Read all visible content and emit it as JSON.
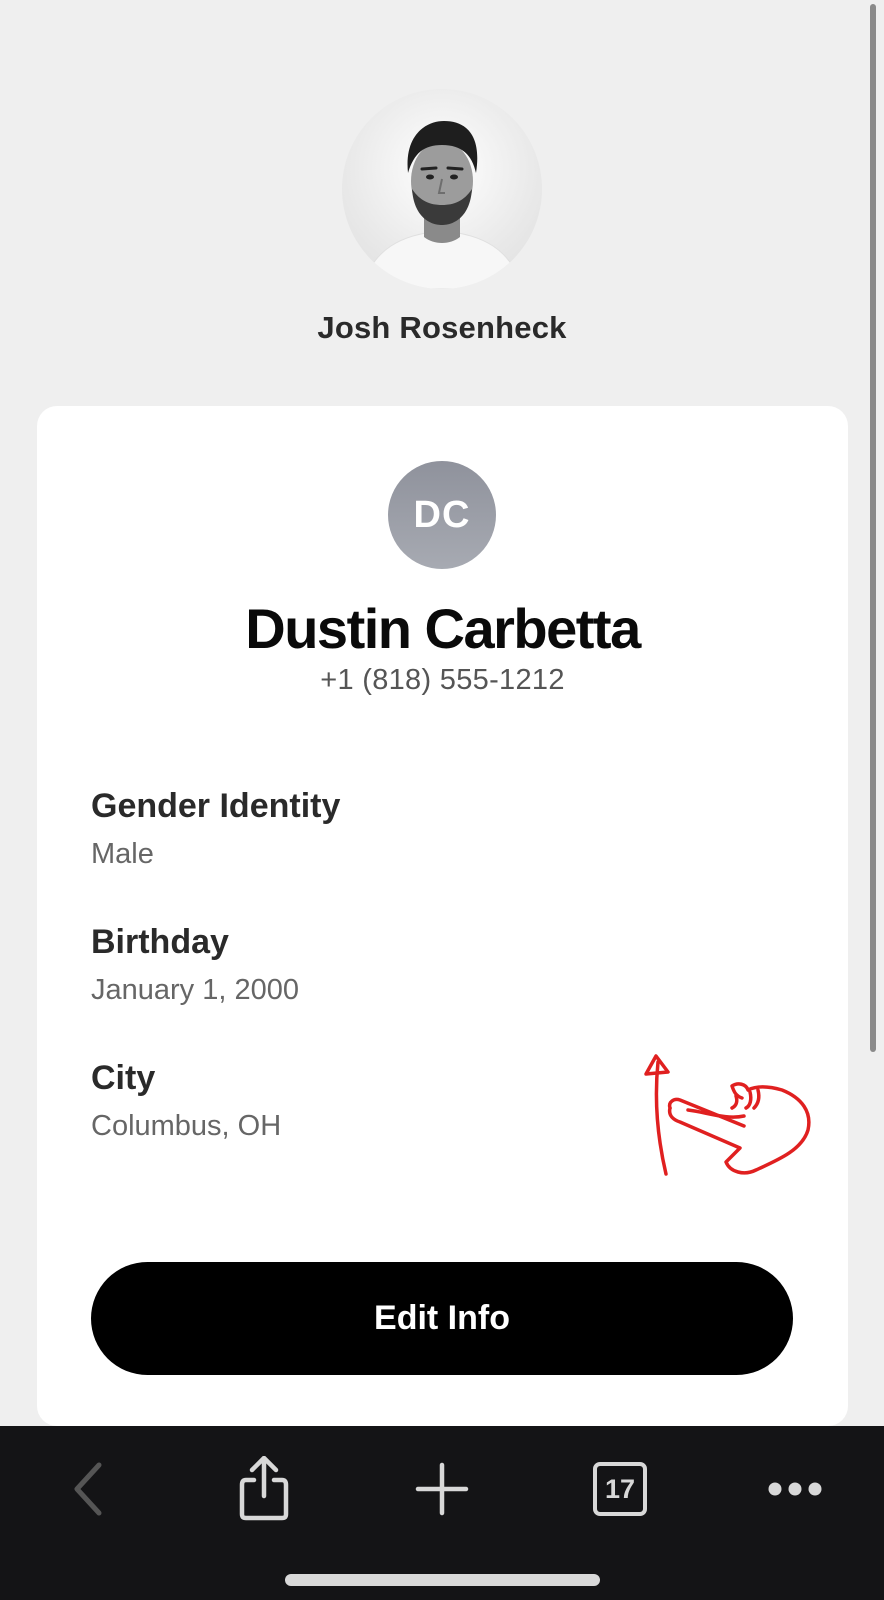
{
  "profile": {
    "name": "Josh Rosenheck"
  },
  "contact": {
    "initials": "DC",
    "name": "Dustin Carbetta",
    "phone": "+1 (818) 555-1212",
    "fields": [
      {
        "label": "Gender Identity",
        "value": "Male"
      },
      {
        "label": "Birthday",
        "value": "January 1, 2000"
      },
      {
        "label": "City",
        "value": "Columbus, OH"
      }
    ],
    "edit_label": "Edit Info"
  },
  "toolbar": {
    "tabs_count": "17",
    "items": [
      "chevron-left-icon",
      "share-icon",
      "plus-icon",
      "tabs-icon",
      "more-icon"
    ]
  },
  "colors": {
    "background": "#efefef",
    "card": "#ffffff",
    "button": "#000000",
    "toolbar": "#141416",
    "annotation": "#e02020",
    "avatar": "#9a9da6"
  }
}
